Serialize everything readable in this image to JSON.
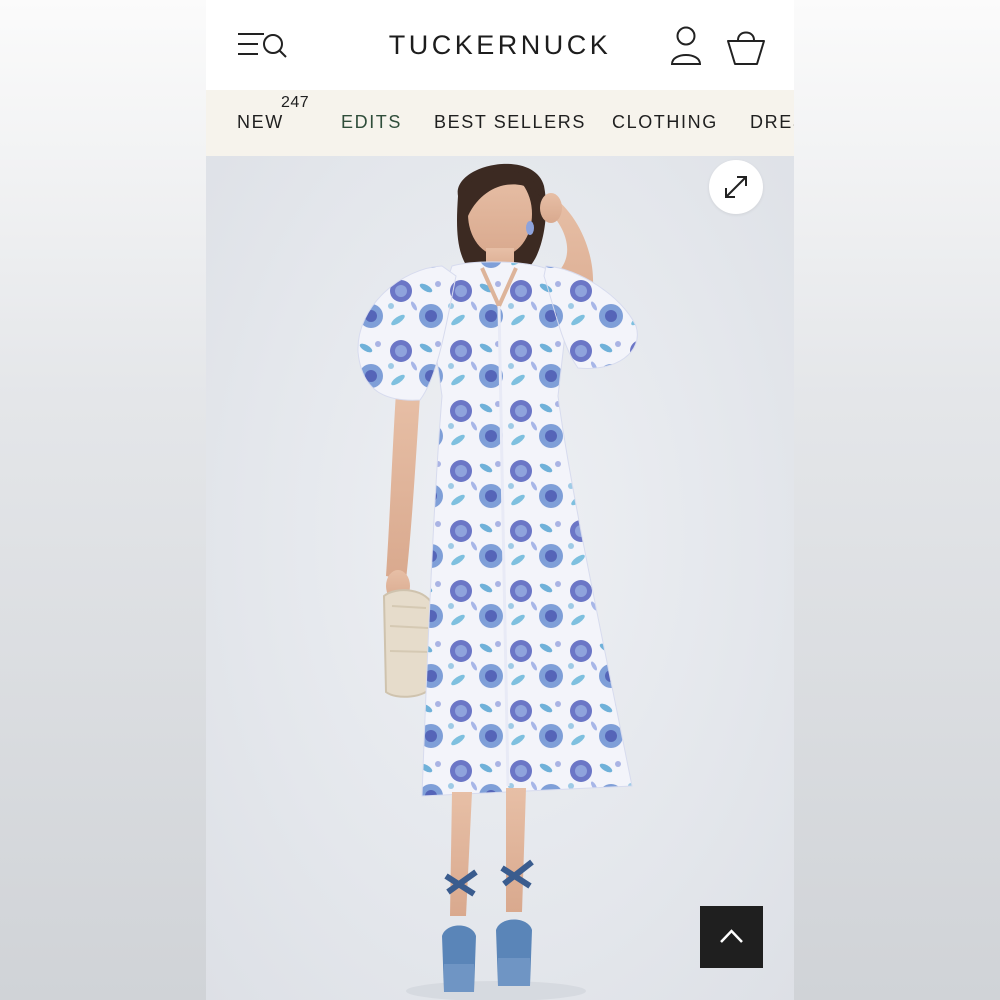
{
  "header": {
    "brand": "TUCKERNUCK",
    "menu_icon": "menu-search-icon",
    "account_icon": "user-icon",
    "bag_icon": "shopping-bag-icon"
  },
  "nav": {
    "items": [
      {
        "label": "NEW",
        "badge": "247"
      },
      {
        "label": "EDITS"
      },
      {
        "label": "BEST SELLERS"
      },
      {
        "label": "CLOTHING"
      },
      {
        "label": "DRESSES"
      }
    ]
  },
  "product": {
    "image_subject": "model wearing blue floral puff-sleeve midi dress",
    "expand_icon": "expand-arrows-icon",
    "scroll_top_icon": "chevron-up-icon"
  },
  "colors": {
    "nav_background": "#f6f3ec",
    "edits_accent": "#2f4d3a",
    "dress_blue": "#6f7fc9",
    "scroll_button": "#1f1f1f"
  }
}
